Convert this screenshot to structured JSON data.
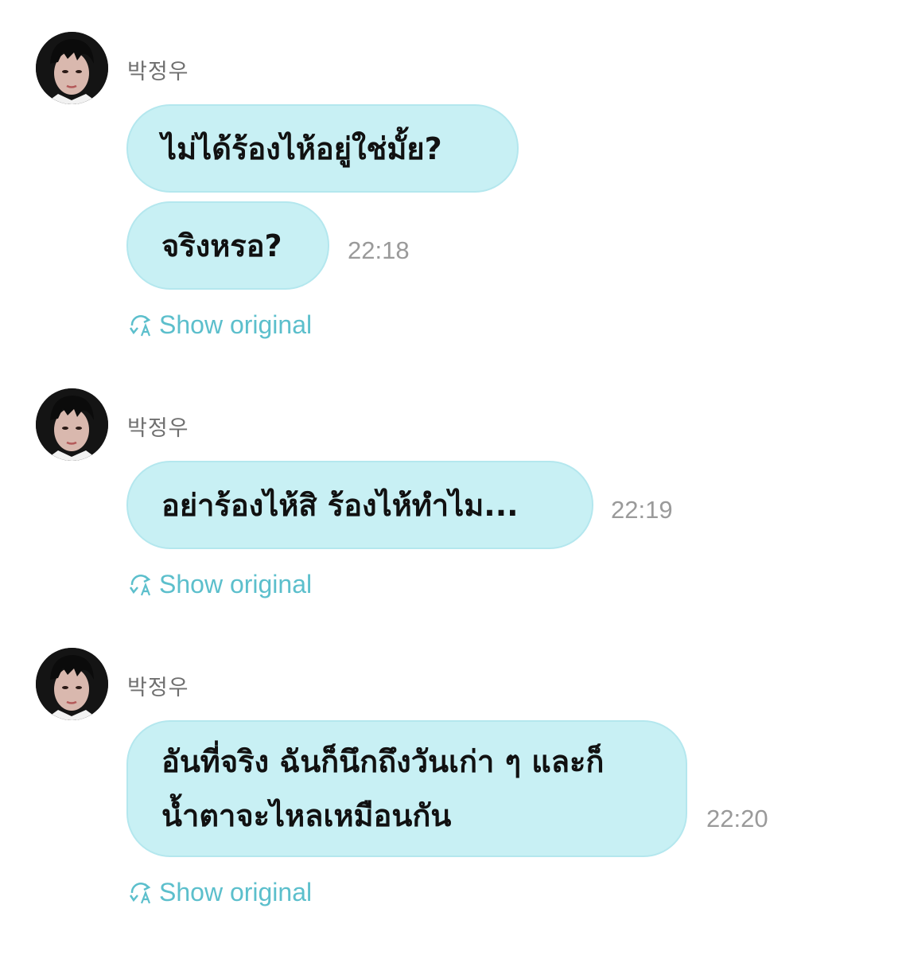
{
  "colors": {
    "bubble_bg": "#c8f0f4",
    "accent": "#5cbfcc",
    "timestamp": "#9a9a9a",
    "sender": "#6f6f6f"
  },
  "messages": [
    {
      "sender": "박정우",
      "avatar_icon": "avatar-photo",
      "bubbles": [
        {
          "text": "ไม่ได้ร้องไห้อยู่ใช่มั้ย?"
        },
        {
          "text": "จริงหรอ?",
          "time": "22:18"
        }
      ],
      "show_original": "Show original",
      "translate_icon": "translate-icon"
    },
    {
      "sender": "박정우",
      "avatar_icon": "avatar-photo",
      "bubbles": [
        {
          "text": "อย่าร้องไห้สิ ร้องไห้ทำไม...",
          "time": "22:19"
        }
      ],
      "show_original": "Show original",
      "translate_icon": "translate-icon"
    },
    {
      "sender": "박정우",
      "avatar_icon": "avatar-photo",
      "bubbles": [
        {
          "text_line1": "อันที่จริง ฉันก็นึกถึงวันเก่า ๆ และก็",
          "text_line2": "น้ำตาจะไหลเหมือนกัน",
          "time": "22:20"
        }
      ],
      "show_original": "Show original",
      "translate_icon": "translate-icon"
    }
  ]
}
